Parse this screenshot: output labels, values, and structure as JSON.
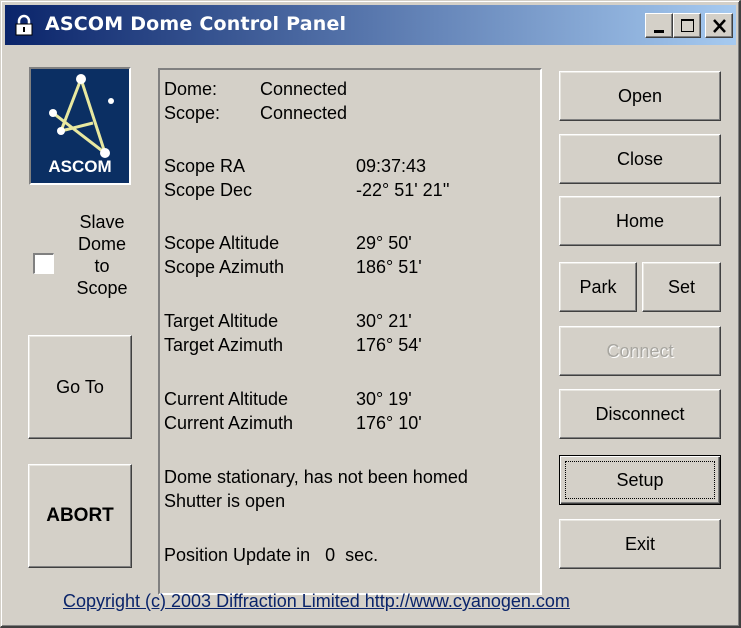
{
  "window": {
    "title": "ASCOM Dome Control Panel"
  },
  "logo": {
    "text": "ASCOM"
  },
  "slave": {
    "label": "Slave\nDome\nto\nScope",
    "checked": false
  },
  "status": {
    "dome_label": "Dome:",
    "dome_value": "Connected",
    "scope_label": "Scope:",
    "scope_value": "Connected",
    "rows": [
      {
        "label": "Scope RA",
        "value": "09:37:43"
      },
      {
        "label": "Scope Dec",
        "value": "-22° 51' 21''"
      },
      {
        "label": "Scope Altitude",
        "value": "29° 50'"
      },
      {
        "label": "Scope Azimuth",
        "value": "186° 51'"
      },
      {
        "label": "Target Altitude",
        "value": "30° 21'"
      },
      {
        "label": "Target Azimuth",
        "value": "176° 54'"
      },
      {
        "label": "Current Altitude",
        "value": "30° 19'"
      },
      {
        "label": "Current Azimuth",
        "value": "176° 10'"
      }
    ],
    "dome_state": "Dome stationary, has not been homed",
    "shutter_state": "Shutter is open",
    "position_update": "Position Update in   0  sec."
  },
  "buttons": {
    "goto": "Go To",
    "abort": "ABORT",
    "open": "Open",
    "close": "Close",
    "home": "Home",
    "park": "Park",
    "set": "Set",
    "connect": "Connect",
    "disconnect": "Disconnect",
    "setup": "Setup",
    "exit": "Exit"
  },
  "footer": {
    "copyright": "Copyright (c) 2003 Diffraction Limited  http://www.cyanogen.com"
  },
  "colors": {
    "face": "#d4d0c8",
    "title_start": "#0a246a",
    "title_end": "#a6caf0",
    "logo_bg": "#0b2f63",
    "link": "#0a246a"
  }
}
